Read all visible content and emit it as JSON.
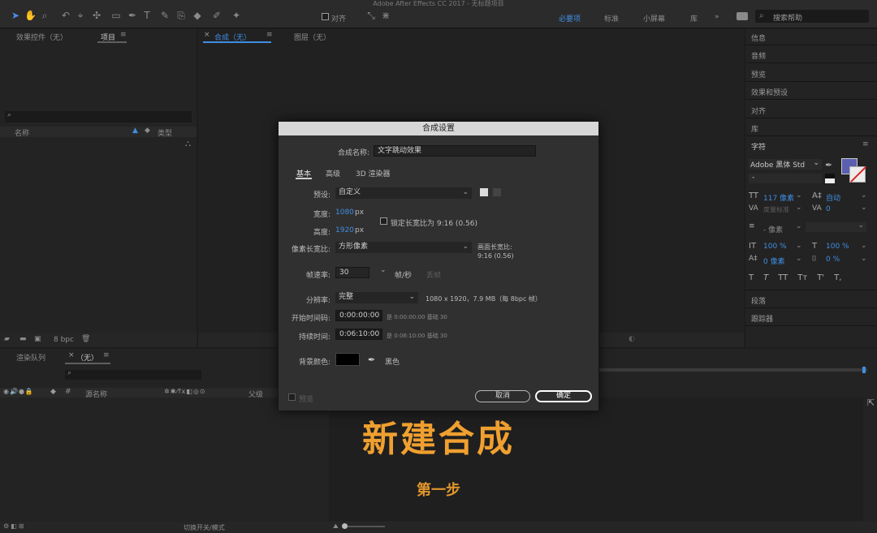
{
  "app": {
    "title": "Adobe After Effects CC 2017 - 无标题项目"
  },
  "toolbar": {
    "align_label": "对齐",
    "workspaces": [
      "必要项",
      "标准",
      "小屏幕",
      "库"
    ],
    "search_placeholder": "搜索帮助"
  },
  "left_panel": {
    "tabs": [
      "效果控件（无）",
      "项目"
    ],
    "columns": {
      "name": "名称",
      "type": "类型"
    },
    "bpc": "8 bpc"
  },
  "comp_panel": {
    "tabs": [
      "合成（无）",
      "图层（无）"
    ],
    "close": "×"
  },
  "right_panel": {
    "items": [
      "信息",
      "音频",
      "预览",
      "效果和预设",
      "对齐",
      "库"
    ],
    "char_title": "字符",
    "font_name": "Adobe 黑体 Std",
    "font_style": "-",
    "size": "117 像素",
    "leading": "自动",
    "kerning": "度量标准",
    "tracking": "0",
    "stroke": "- 像素",
    "vscale": "100 %",
    "hscale": "100 %",
    "baseline": "0 像素",
    "tsume": "0 %",
    "styles": [
      "T",
      "T",
      "TT",
      "Tт",
      "T'",
      "T,"
    ],
    "paragraph": "段落",
    "tracker": "跟踪器",
    "color_fill": "#5b5fb0"
  },
  "timeline": {
    "tabs": [
      "渲染队列",
      "（无）"
    ],
    "close": "×",
    "column_source": "源名称",
    "column_parent": "父级",
    "switch_label": "切换开关/模式",
    "big_text": "新建合成",
    "sub_text": "第一步"
  },
  "dialog": {
    "title": "合成设置",
    "name_label": "合成名称:",
    "name_value": "文字跳动效果",
    "tabs": [
      "基本",
      "高级",
      "3D 渲染器"
    ],
    "preset_label": "预设:",
    "preset_value": "自定义",
    "width_label": "宽度:",
    "width_value": "1080",
    "height_label": "高度:",
    "height_value": "1920",
    "px": "px",
    "lock_label": "锁定长宽比为 9:16 (0.56)",
    "par_label": "像素长宽比:",
    "par_value": "方形像素",
    "frame_aspect_label": "画面长宽比:",
    "frame_aspect_value": "9:16 (0.56)",
    "fps_label": "帧速率:",
    "fps_value": "30",
    "fps_unit": "帧/秒",
    "drop_frame": "丢帧",
    "resolution_label": "分辨率:",
    "resolution_value": "完整",
    "resolution_info": "1080 x 1920，7.9 MB（每 8bpc 帧）",
    "start_label": "开始时间码:",
    "start_value": "0:00:00:00",
    "start_info": "是 0:00:00:00  基础 30",
    "duration_label": "持续时间:",
    "duration_value": "0:06:10:00",
    "duration_info": "是 0:06:10:00  基础 30",
    "bg_label": "背景颜色:",
    "bg_name": "黑色",
    "preview_label": "预览",
    "cancel": "取消",
    "ok": "确定"
  }
}
